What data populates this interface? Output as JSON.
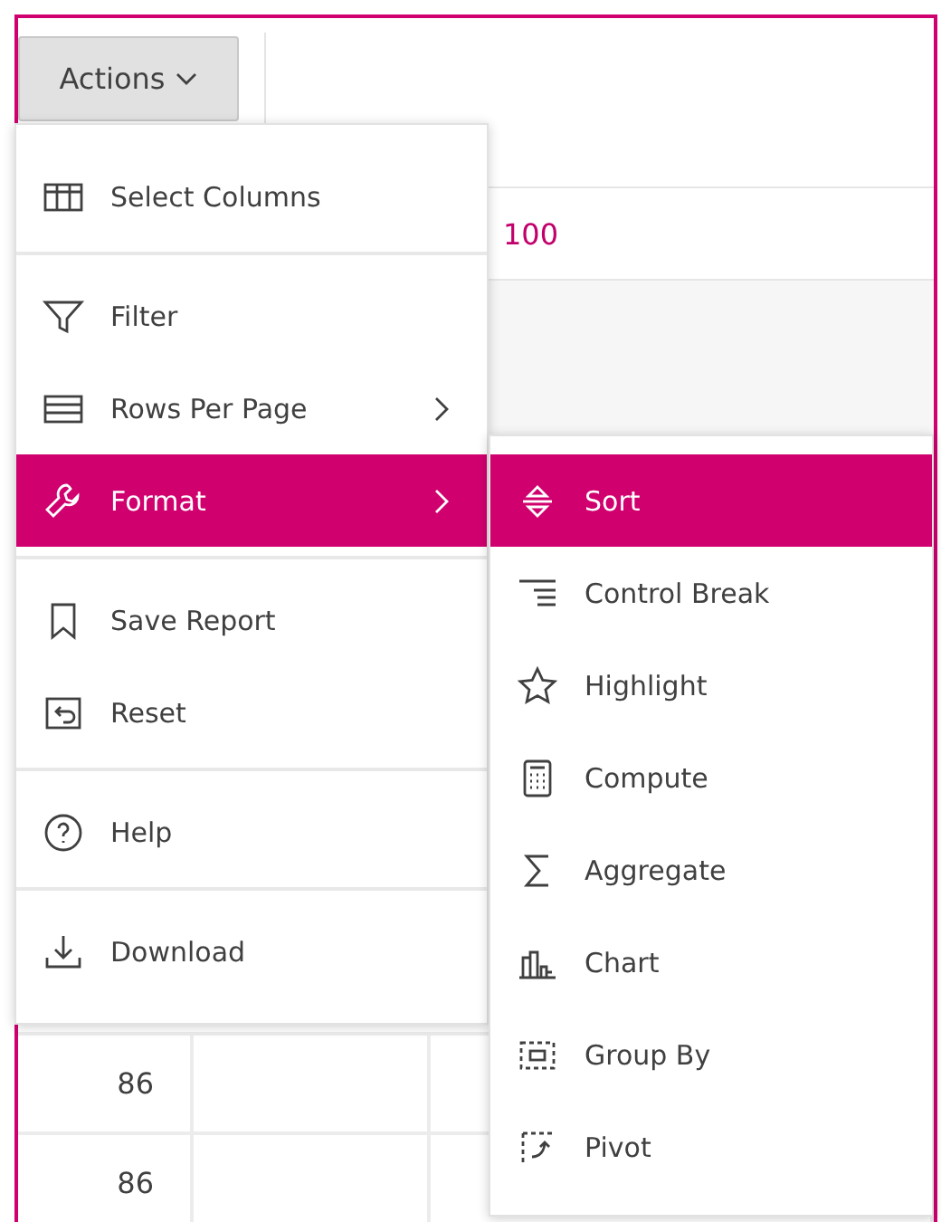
{
  "toolbar": {
    "actions_button": {
      "label": "Actions"
    }
  },
  "filter": {
    "text": "100"
  },
  "table": {
    "rows": [
      {
        "cells": [
          "86"
        ]
      },
      {
        "cells": [
          "86"
        ]
      }
    ]
  },
  "actions_menu": {
    "groups": [
      {
        "items": [
          {
            "label": "Select Columns",
            "selected": false,
            "has_submenu": false
          }
        ]
      },
      {
        "items": [
          {
            "label": "Filter",
            "selected": false,
            "has_submenu": false
          },
          {
            "label": "Rows Per Page",
            "selected": false,
            "has_submenu": true
          },
          {
            "label": "Format",
            "selected": true,
            "has_submenu": true
          }
        ]
      },
      {
        "items": [
          {
            "label": "Save Report",
            "selected": false,
            "has_submenu": false
          },
          {
            "label": "Reset",
            "selected": false,
            "has_submenu": false
          }
        ]
      },
      {
        "items": [
          {
            "label": "Help",
            "selected": false,
            "has_submenu": false
          }
        ]
      },
      {
        "items": [
          {
            "label": "Download",
            "selected": false,
            "has_submenu": false
          }
        ]
      }
    ]
  },
  "format_submenu": {
    "items": [
      {
        "label": "Sort",
        "selected": true
      },
      {
        "label": "Control Break",
        "selected": false
      },
      {
        "label": "Highlight",
        "selected": false
      },
      {
        "label": "Compute",
        "selected": false
      },
      {
        "label": "Aggregate",
        "selected": false
      },
      {
        "label": "Chart",
        "selected": false
      },
      {
        "label": "Group By",
        "selected": false
      },
      {
        "label": "Pivot",
        "selected": false
      }
    ]
  }
}
